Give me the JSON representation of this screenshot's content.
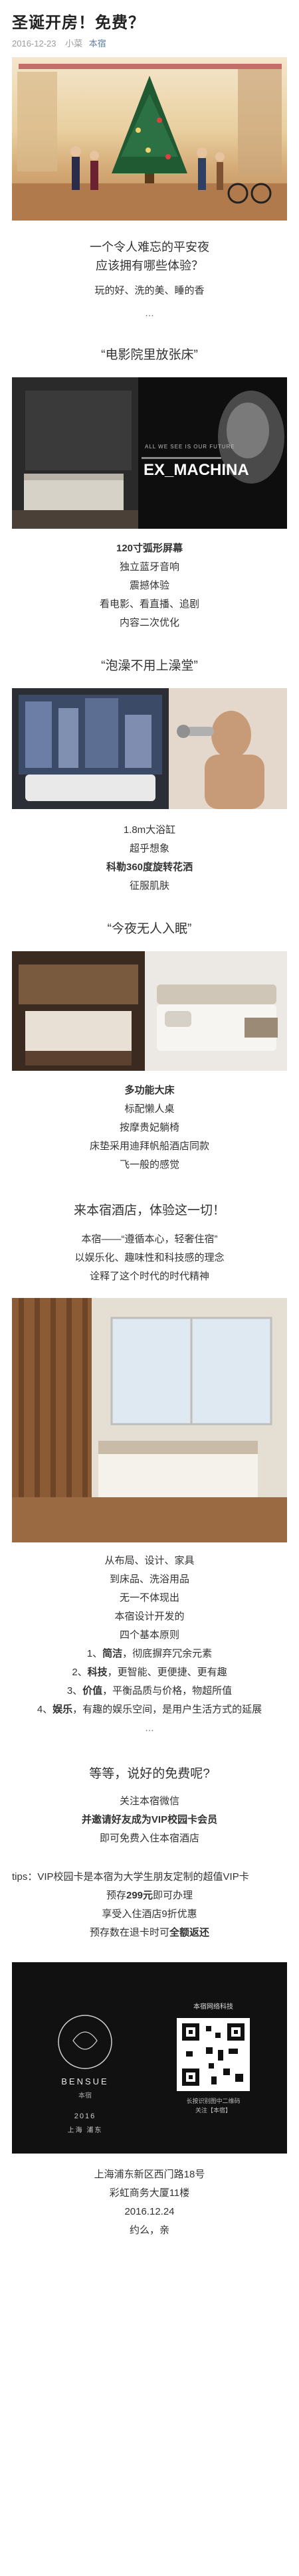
{
  "article": {
    "title": "圣诞开房！免费？",
    "date": "2016-12-23",
    "author": "小菜",
    "account": "本宿"
  },
  "intro": {
    "line1": "一个令人难忘的平安夜",
    "line2": "应该拥有哪些体验？",
    "line3": "玩的好、洗的美、睡的香",
    "dots": "…"
  },
  "section_cinema": {
    "heading": "“电影院里放张床”",
    "poster_text_small": "ALL WE SEE IS OUR FUTURE",
    "poster_title": "EX_MACHINA",
    "lines": [
      "120寸弧形屏幕",
      "独立蓝牙音响",
      "震撼体验",
      "看电影、看直播、追剧",
      "内容二次优化"
    ]
  },
  "section_bath": {
    "heading": "“泡澡不用上澡堂”",
    "lines": [
      "1.8m大浴缸",
      "超乎想象",
      "科勒360度旋转花洒",
      "征服肌肤"
    ]
  },
  "section_bed": {
    "heading": "“今夜无人入眠”",
    "lines": [
      "多功能大床",
      "标配懒人桌",
      "按摩贵妃躺椅",
      "床垫采用迪拜帆船酒店同款",
      "飞一般的感觉"
    ]
  },
  "section_intro_hotel": {
    "heading": "来本宿酒店，体验这一切！",
    "lines": [
      "本宿——“遵循本心，轻奢住宿”",
      "以娱乐化、趣味性和科技感的理念",
      "诠释了这个时代的时代精神"
    ],
    "after_image_lines": [
      "从布局、设计、家具",
      "到床品、洗浴用品",
      "无一不体现出",
      "本宿设计开发的",
      "四个基本原则"
    ],
    "principles": [
      {
        "num": "1、",
        "name": "简洁",
        "desc": "，彻底摒弃冗余元素"
      },
      {
        "num": "2、",
        "name": "科技",
        "desc": "，更智能、更便捷、更有趣"
      },
      {
        "num": "3、",
        "name": "价值",
        "desc": "，平衡品质与价格，物超所值"
      },
      {
        "num": "4、",
        "name": "娱乐",
        "desc": "，有趣的娱乐空间，是用户生活方式的延展"
      }
    ],
    "dots": "…"
  },
  "section_free": {
    "heading": "等等，说好的免费呢?",
    "lines": [
      "关注本宿微信",
      "并邀请好友成为VIP校园卡会员",
      "即可免费入住本宿酒店"
    ]
  },
  "tips": {
    "line1": "tips：VIP校园卡是本宿为大学生朋友定制的超值VIP卡",
    "line2_pre": "预存",
    "line2_bold": "299元",
    "line2_post": "即可办理",
    "line3": "享受入住酒店9折优惠",
    "line4_pre": "预存数在退卡时可",
    "line4_bold": "全额返还"
  },
  "footer_card": {
    "brand": "BENSUE",
    "brand_cn": "本宿",
    "year": "2016",
    "city": "上海 浦东",
    "tech": "本宿网络科技",
    "qr_caption": "长按识别图中二维码",
    "follow": "关注【本宿】"
  },
  "address": {
    "line1": "上海浦东新区西门路18号",
    "line2": "彩虹商务大厦11楼",
    "line3": "2016.12.24",
    "line4": "约么，亲"
  },
  "colors": {
    "accent_link": "#607fa6",
    "bold_red": "#c00000",
    "dark_card": "#111111"
  }
}
